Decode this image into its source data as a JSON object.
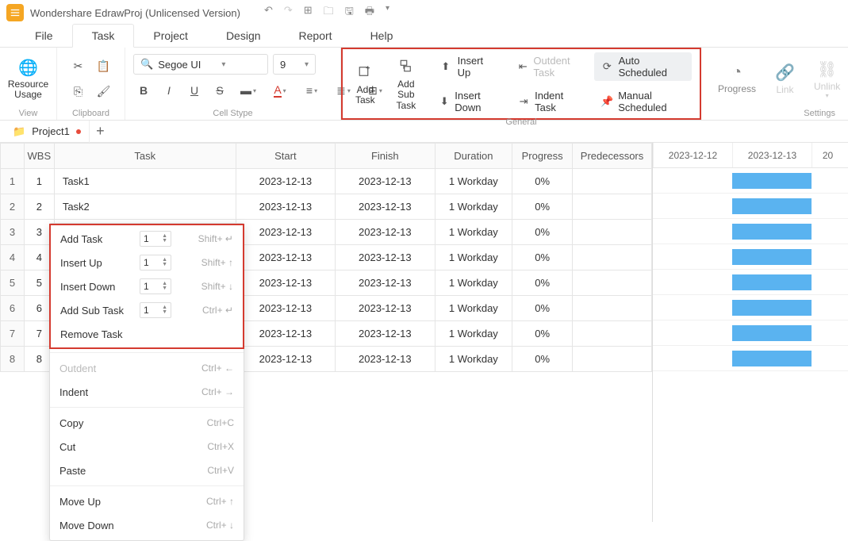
{
  "app": {
    "title": "Wondershare EdrawProj (Unlicensed Version)"
  },
  "menu": {
    "tabs": [
      "File",
      "Task",
      "Project",
      "Design",
      "Report",
      "Help"
    ],
    "activeIndex": 1
  },
  "ribbon": {
    "view": {
      "resource_usage": "Resource\nUsage",
      "label": "View"
    },
    "clipboard": {
      "label": "Clipboard"
    },
    "cellstyle": {
      "font": "Segoe UI",
      "size": "9",
      "label": "Cell Stype"
    },
    "general": {
      "label": "General",
      "add_task": "Add\nTask",
      "add_sub_task": "Add Sub\nTask",
      "insert_up": "Insert Up",
      "insert_down": "Insert Down",
      "outdent": "Outdent Task",
      "indent": "Indent Task",
      "auto": "Auto Scheduled",
      "manual": "Manual Scheduled"
    },
    "settings": {
      "progress": "Progress",
      "link": "Link",
      "unlink": "Unlink",
      "label": "Settings"
    }
  },
  "project": {
    "name": "Project1"
  },
  "table": {
    "headers": {
      "wbs": "WBS",
      "task": "Task",
      "start": "Start",
      "finish": "Finish",
      "duration": "Duration",
      "progress": "Progress",
      "predecessors": "Predecessors"
    },
    "rows": [
      {
        "n": "1",
        "wbs": "1",
        "task": "Task1",
        "start": "2023-12-13",
        "finish": "2023-12-13",
        "dur": "1 Workday",
        "prog": "0%"
      },
      {
        "n": "2",
        "wbs": "2",
        "task": "Task2",
        "start": "2023-12-13",
        "finish": "2023-12-13",
        "dur": "1 Workday",
        "prog": "0%"
      },
      {
        "n": "3",
        "wbs": "3",
        "task": "",
        "start": "2023-12-13",
        "finish": "2023-12-13",
        "dur": "1 Workday",
        "prog": "0%"
      },
      {
        "n": "4",
        "wbs": "4",
        "task": "",
        "start": "2023-12-13",
        "finish": "2023-12-13",
        "dur": "1 Workday",
        "prog": "0%"
      },
      {
        "n": "5",
        "wbs": "5",
        "task": "",
        "start": "2023-12-13",
        "finish": "2023-12-13",
        "dur": "1 Workday",
        "prog": "0%"
      },
      {
        "n": "6",
        "wbs": "6",
        "task": "",
        "start": "2023-12-13",
        "finish": "2023-12-13",
        "dur": "1 Workday",
        "prog": "0%"
      },
      {
        "n": "7",
        "wbs": "7",
        "task": "",
        "start": "2023-12-13",
        "finish": "2023-12-13",
        "dur": "1 Workday",
        "prog": "0%"
      },
      {
        "n": "8",
        "wbs": "8",
        "task": "",
        "start": "2023-12-13",
        "finish": "2023-12-13",
        "dur": "1 Workday",
        "prog": "0%"
      }
    ]
  },
  "gantt": {
    "dates": [
      "2023-12-12",
      "2023-12-13",
      "20"
    ]
  },
  "ctx": {
    "add_task": "Add Task",
    "add_task_sc": "Shift+ ↵",
    "insert_up": "Insert Up",
    "insert_up_sc": "Shift+ ↑",
    "insert_down": "Insert Down",
    "insert_down_sc": "Shift+ ↓",
    "add_sub": "Add Sub Task",
    "add_sub_sc": "Ctrl+ ↵",
    "remove": "Remove Task",
    "outdent": "Outdent",
    "outdent_sc": "Ctrl+ ←",
    "indent": "Indent",
    "indent_sc": "Ctrl+ →",
    "copy": "Copy",
    "copy_sc": "Ctrl+C",
    "cut": "Cut",
    "cut_sc": "Ctrl+X",
    "paste": "Paste",
    "paste_sc": "Ctrl+V",
    "move_up": "Move Up",
    "move_up_sc": "Ctrl+ ↑",
    "move_down": "Move Down",
    "move_down_sc": "Ctrl+ ↓",
    "spin_val": "1"
  }
}
